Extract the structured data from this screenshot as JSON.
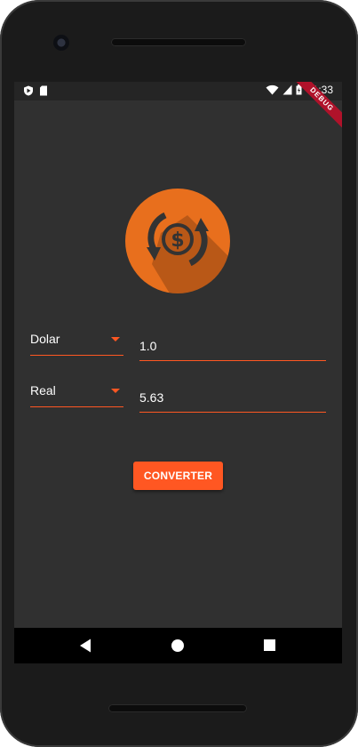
{
  "status_bar": {
    "time": "11:33",
    "debug_banner": "DEBUG",
    "icons": [
      "play-protect-icon",
      "sd-card-icon",
      "wifi-icon",
      "signal-icon",
      "battery-icon"
    ]
  },
  "app": {
    "logo": "currency-exchange-icon",
    "from": {
      "currency": "Dolar",
      "value": "1.0"
    },
    "to": {
      "currency": "Real",
      "value": "5.63"
    },
    "convert_label": "CONVERTER"
  },
  "navigation": {
    "items": [
      "back-icon",
      "home-icon",
      "recent-apps-icon"
    ]
  },
  "colors": {
    "accent": "#ff5722",
    "logo_circle": "#e86f1d",
    "background": "#303030"
  }
}
